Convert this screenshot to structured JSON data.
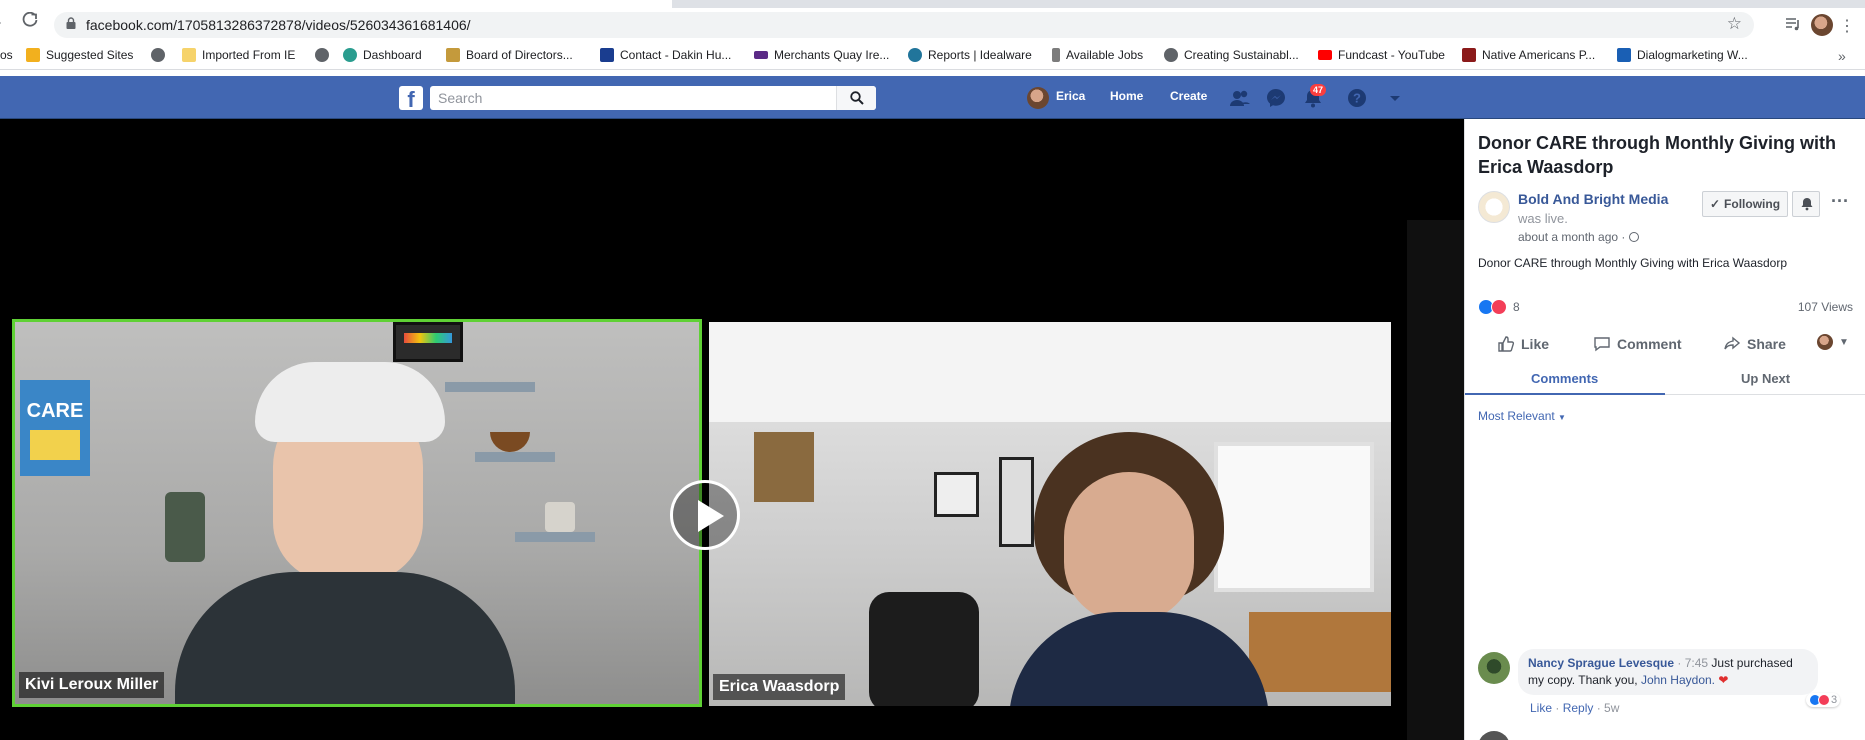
{
  "browser": {
    "url": "facebook.com/1705813286372878/videos/526034361681406/",
    "bookmarks": [
      {
        "label": "os",
        "icon": "apps-icon",
        "color": "#5f6368"
      },
      {
        "label": "Suggested Sites",
        "icon": "bing-icon",
        "color": "#f2b01e"
      },
      {
        "label": "",
        "icon": "globe-icon",
        "color": "#5f6368"
      },
      {
        "label": "Imported From IE",
        "icon": "folder-icon",
        "color": "#f6d36b"
      },
      {
        "label": "Dashboard",
        "icon": "globe-icon",
        "color": "#5f6368"
      },
      {
        "label": "Board of Directors...",
        "icon": "page-icon",
        "color": "#1a73e8"
      },
      {
        "label": "Contact - Dakin Hu...",
        "icon": "shield-icon",
        "color": "#1a3d8f"
      },
      {
        "label": "Merchants Quay Ire...",
        "icon": "mq-icon",
        "color": "#5b2a86"
      },
      {
        "label": "Reports | Idealware",
        "icon": "wordpress-icon",
        "color": "#21759b"
      },
      {
        "label": "Available Jobs",
        "icon": "leaf-icon",
        "color": "#7c7c7c"
      },
      {
        "label": "Creating Sustainabl...",
        "icon": "globe-icon",
        "color": "#5f6368"
      },
      {
        "label": "Fundcast - YouTube",
        "icon": "youtube-icon",
        "color": "#ff0000"
      },
      {
        "label": "Native Americans P...",
        "icon": "page-icon",
        "color": "#8b1a1a"
      },
      {
        "label": "Dialogmarketing W...",
        "icon": "page-icon",
        "color": "#1a5fb4"
      }
    ]
  },
  "fb": {
    "logo_letter": "f",
    "search_placeholder": "Search",
    "user_name": "Erica",
    "nav_home": "Home",
    "nav_create": "Create",
    "notification_count": "47"
  },
  "video": {
    "left_name": "Kivi Leroux Miller",
    "right_name": "Erica Waasdorp",
    "book_label": "CARE"
  },
  "panel": {
    "title": "Donor CARE through Monthly Giving with Erica Waasdorp",
    "page_name": "Bold And Bright Media",
    "was_live": "was live.",
    "time": "about a month ago · ",
    "follow_label": "Following",
    "description": "Donor CARE through Monthly Giving with Erica Waasdorp",
    "reaction_count": "8",
    "views": "107 Views",
    "like": "Like",
    "comment": "Comment",
    "share": "Share",
    "tab_comments": "Comments",
    "tab_upnext": "Up Next",
    "sort": "Most Relevant"
  },
  "comment": {
    "author": "Nancy Sprague Levesque",
    "time": " · 7:45",
    "text": " Just purchased my copy. Thank you, ",
    "mention": "John Haydon.",
    "heart": " ❤",
    "reaction_count": "3",
    "like": "Like",
    "reply": "Reply",
    "age": "5w"
  }
}
